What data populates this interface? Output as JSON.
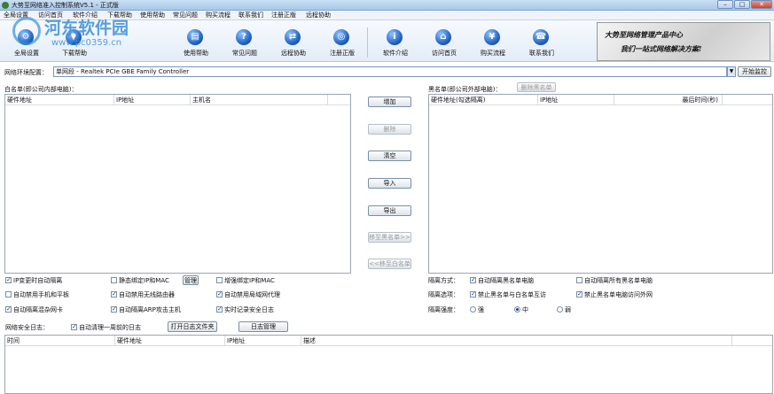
{
  "window": {
    "title": "大势至网络准入控制系统V5.1 - 正式版",
    "controls": [
      "–",
      "□",
      "✕"
    ]
  },
  "menu": [
    "全局设置",
    "访问首页",
    "软件介绍",
    "下载帮助",
    "使用帮助",
    "常见问题",
    "购买流程",
    "联系我们",
    "注册正版",
    "远程协助"
  ],
  "toolbar": [
    {
      "label": "全局设置",
      "icon": "settings-icon"
    },
    {
      "label": "下载帮助",
      "icon": "download-icon"
    },
    {
      "label": "使用帮助",
      "icon": "help-book-icon"
    },
    {
      "label": "常见问题",
      "icon": "question-icon"
    },
    {
      "label": "远程协助",
      "icon": "remote-icon"
    },
    {
      "label": "注册正版",
      "icon": "register-icon"
    },
    {
      "label": "软件介绍",
      "icon": "info-icon"
    },
    {
      "label": "访问首页",
      "icon": "home-icon"
    },
    {
      "label": "购买流程",
      "icon": "cart-icon"
    },
    {
      "label": "联系我们",
      "icon": "phone-icon"
    }
  ],
  "banner": {
    "line1": "大势至网络管理产品中心",
    "line2": "我们一站式网络解决方案!"
  },
  "watermark": {
    "name": "河东软件园",
    "url": "www.pc0359.cn"
  },
  "network": {
    "label": "网络环境配置：",
    "selected": "单网段 - Realtek PCIe GBE Family Controller",
    "start_button": "开始监控"
  },
  "whitelist": {
    "label": "白名单(即公司内部电脑)：",
    "columns": [
      "硬件地址",
      "IP地址",
      "主机名"
    ]
  },
  "blacklist": {
    "label": "黑名单(即公司外部电脑)：",
    "delete_button": "删除黑名单",
    "columns": [
      "硬件地址(勾选隔离)",
      "IP地址",
      "最后时间(秒)"
    ]
  },
  "actions": {
    "add": "增加",
    "delete": "删除",
    "clear": "清空",
    "import": "导入",
    "export": "导出",
    "move_to_black": "移至黑名单>>",
    "move_to_white": "<<移至白名单"
  },
  "options": {
    "ip_change_isolate": {
      "label": "IP变更时自动隔离",
      "checked": true
    },
    "static_bind": {
      "label": "静态绑定IP和MAC",
      "checked": false
    },
    "manage_button": "管理",
    "two_way_bind": {
      "label": "增强绑定IP和MAC",
      "checked": false
    },
    "block_phone": {
      "label": "自动禁用手机和平板",
      "checked": false
    },
    "block_router": {
      "label": "自动禁用无线路由器",
      "checked": true
    },
    "block_proxy": {
      "label": "自动禁用局域网代理",
      "checked": true
    },
    "isolate_mixed": {
      "label": "自动隔离混杂网卡",
      "checked": true
    },
    "isolate_arp": {
      "label": "自动隔离ARP攻击主机",
      "checked": true
    },
    "record_log": {
      "label": "实时记录安全日志",
      "checked": true
    }
  },
  "isolation": {
    "mode_label": "隔离方式：",
    "mode_auto_black": {
      "label": "自动隔离黑名单电脑",
      "checked": true
    },
    "mode_auto_new": {
      "label": "自动隔离所有黑名单电脑",
      "checked": false
    },
    "option_label": "隔离选项：",
    "option_no_mutual": {
      "label": "禁止黑名单与白名单互访",
      "checked": true
    },
    "option_no_external": {
      "label": "禁止黑名单电脑访问外网",
      "checked": true
    },
    "strength_label": "隔离强度：",
    "strength_options": [
      "强",
      "中",
      "弱"
    ],
    "strength_selected": "中"
  },
  "log": {
    "label": "网络安全日志：",
    "auto_clear": {
      "label": "自动清理一周前的日志",
      "checked": true
    },
    "open_folder": "打开日志文件夹",
    "manage": "日志管理",
    "columns": [
      "时间",
      "硬件地址",
      "IP地址",
      "描述"
    ]
  },
  "colors": {
    "titlebar": "#c9dff3",
    "toolbar_bg": "#e3ecf7",
    "icon_blue": "#1e5fbf",
    "watermark": "#3b8fd8"
  }
}
